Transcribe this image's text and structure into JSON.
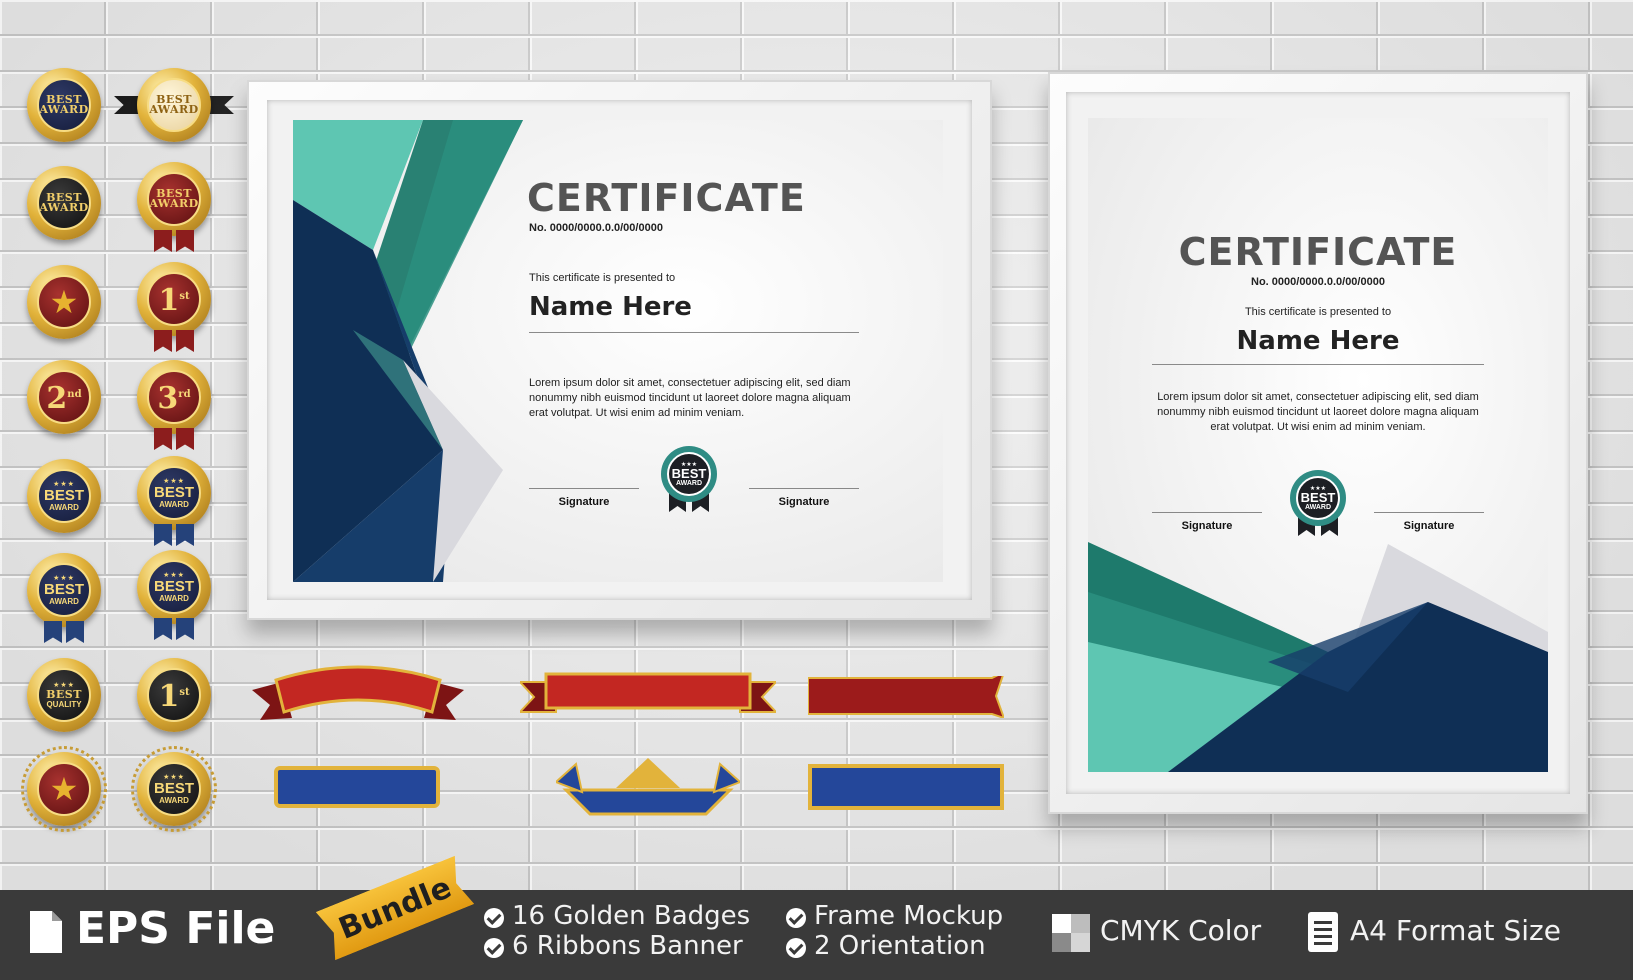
{
  "badges": {
    "b1": {
      "line1": "BEST",
      "line2": "AWARD"
    },
    "b2": {
      "line1": "BEST",
      "line2": "AWARD"
    },
    "b3": {
      "line1": "BEST",
      "line2": "AWARD"
    },
    "b4": {
      "line1": "BEST",
      "line2": "AWARD"
    },
    "b6": {
      "num": "1",
      "suffix": "st"
    },
    "b7": {
      "num": "2",
      "suffix": "nd"
    },
    "b8": {
      "num": "3",
      "suffix": "rd"
    },
    "b9": {
      "line1": "BEST",
      "line2": "AWARD"
    },
    "b10": {
      "line1": "BEST",
      "line2": "AWARD"
    },
    "b11": {
      "line1": "BEST",
      "line2": "AWARD"
    },
    "b12": {
      "line1": "BEST",
      "line2": "AWARD"
    },
    "b13": {
      "line1": "BEST",
      "line2": "QUALITY"
    },
    "b14": {
      "num": "1",
      "suffix": "st"
    },
    "b16": {
      "line1": "BEST",
      "line2": "AWARD"
    }
  },
  "certificate_landscape": {
    "title": "CERTIFICATE",
    "number": "No. 0000/0000.0.0/00/0000",
    "presented": "This certificate is presented to",
    "name": "Name Here",
    "body": "Lorem ipsum dolor sit amet, consectetuer adipiscing elit, sed diam nonummy nibh euismod tincidunt ut laoreet dolore magna aliquam erat volutpat. Ut wisi enim ad minim veniam.",
    "signature_left": "Signature",
    "signature_right": "Signature",
    "seal_line1": "BEST",
    "seal_line2": "AWARD"
  },
  "certificate_portrait": {
    "title": "CERTIFICATE",
    "number": "No. 0000/0000.0.0/00/0000",
    "presented": "This certificate is presented to",
    "name": "Name Here",
    "body": "Lorem ipsum dolor sit amet, consectetuer adipiscing elit, sed diam nonummy nibh euismod tincidunt ut laoreet dolore magna aliquam erat volutpat. Ut wisi enim ad minim veniam.",
    "signature_left": "Signature",
    "signature_right": "Signature",
    "seal_line1": "BEST",
    "seal_line2": "AWARD"
  },
  "footer": {
    "file_label": "EPS File",
    "bundle_label": "Bundle",
    "feature_1": "16 Golden Badges",
    "feature_2": "6  Ribbons Banner",
    "feature_3": "Frame Mockup",
    "feature_4": "2 Orientation",
    "cmyk_label": "CMYK Color",
    "format_label": "A4 Format Size"
  },
  "colors": {
    "teal": "#5ec6b2",
    "dark_teal": "#1e7a6c",
    "navy": "#0f2f55",
    "gold": "#e2b33b",
    "ribbon_red": "#b3201c",
    "ribbon_blue": "#24479a",
    "footer_bg": "#3a3a3a",
    "bundle_orange": "#f2b02a"
  }
}
